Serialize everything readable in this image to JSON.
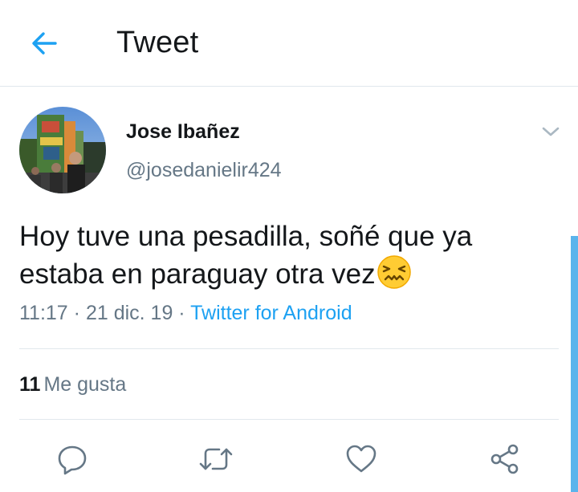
{
  "header": {
    "title": "Tweet",
    "back_icon": "arrow-left-icon",
    "accent_color": "#1da1f2"
  },
  "tweet": {
    "author": {
      "name": "Jose Ibañez",
      "handle": "@josedanielir424"
    },
    "text_line1": "Hoy tuve una pesadilla, soñé que ya",
    "text_line2": "estaba en paraguay otra vez",
    "emoji": "confounded-face-emoji",
    "time": "11:17",
    "sep1": " · ",
    "date": "21 dic. 19",
    "sep2": " · ",
    "source": "Twitter for Android",
    "likes_count": "11",
    "likes_label": "Me gusta"
  },
  "actions": [
    {
      "name": "reply",
      "icon": "reply-icon"
    },
    {
      "name": "retweet",
      "icon": "retweet-icon"
    },
    {
      "name": "like",
      "icon": "heart-icon"
    },
    {
      "name": "share",
      "icon": "share-icon"
    }
  ],
  "colors": {
    "text_primary": "#14171a",
    "text_secondary": "#657786",
    "divider": "#e1e8ed",
    "link": "#1da1f2"
  }
}
